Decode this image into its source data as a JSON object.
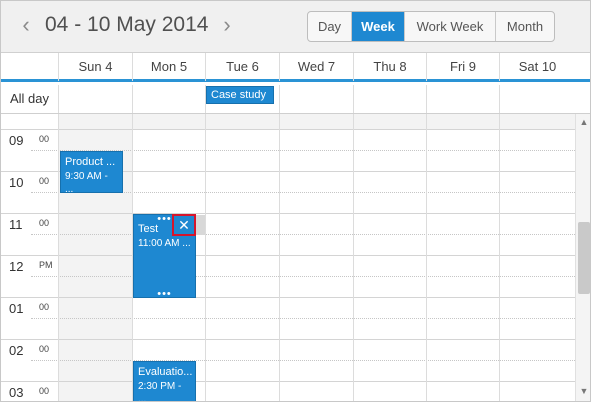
{
  "toolbar": {
    "prev_icon": "chevron-left-icon",
    "next_icon": "chevron-right-icon",
    "date_range": "04 - 10 May 2014",
    "views": [
      "Day",
      "Week",
      "Work Week",
      "Month"
    ],
    "active_view": "Week"
  },
  "days": [
    "Sun 4",
    "Mon 5",
    "Tue 6",
    "Wed 7",
    "Thu 8",
    "Fri 9",
    "Sat 10"
  ],
  "all_day": {
    "label": "All day",
    "events": [
      {
        "title": "Case study",
        "day": "Tue 6"
      }
    ]
  },
  "time_slots": [
    {
      "hour": "09",
      "min": "00"
    },
    {
      "hour": "10",
      "min": "00"
    },
    {
      "hour": "11",
      "min": "00"
    },
    {
      "hour": "12",
      "min": "PM"
    },
    {
      "hour": "01",
      "min": "00"
    },
    {
      "hour": "02",
      "min": "00"
    },
    {
      "hour": "03",
      "min": "00"
    }
  ],
  "events": [
    {
      "title": "Product ...",
      "time": "9:30 AM - ...",
      "day": "Sun 4"
    },
    {
      "title": "Test",
      "time": "11:00 AM ...",
      "day": "Mon 5",
      "selected": true
    },
    {
      "title": "Evaluatio...",
      "time": "2:30 PM - ...",
      "day": "Mon 5"
    }
  ],
  "delete_icon": "close-icon",
  "resize_handle": "•••",
  "colors": {
    "accent": "#1e88d1",
    "header_underline": "#2a93d5",
    "selection_border": "#d6152c"
  }
}
